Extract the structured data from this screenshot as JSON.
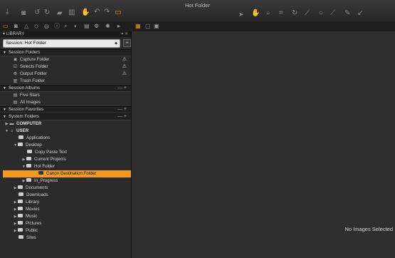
{
  "window": {
    "title": "Hot Folder"
  },
  "toolbar": {
    "left_icons": [
      "import-icon",
      "camera-icon",
      "rotate-left-icon",
      "rotate-right-icon",
      "folder-icon",
      "trash-icon",
      "hand-icon",
      "undo-icon",
      "redo-icon",
      "stack-icon"
    ],
    "right_icons": [
      "select-arrow-icon",
      "pan-icon",
      "zoom-icon",
      "crop-icon",
      "rotate-icon",
      "straighten-icon",
      "circle-icon",
      "picker-icon",
      "brush-icon"
    ],
    "accent": "#f29a1a"
  },
  "tool_tabs": [
    "folder-tab",
    "camera-tab",
    "shape-tab",
    "color-tab",
    "lens-tab",
    "info-tab",
    "search-tab",
    "meta-tab",
    "list-tab",
    "settings-tab",
    "more-tab"
  ],
  "library": {
    "header": "LIBRARY",
    "session_label": "Session: Hot Folder",
    "session_add": "+",
    "sections": {
      "session_folders": "Session Folders",
      "session_albums": "Session Albums",
      "session_favorites": "Session Favorites",
      "system_folders": "System Folders"
    },
    "session_folders": [
      {
        "label": "Capture Folder",
        "icon": "camera-icon",
        "warn": "⚠"
      },
      {
        "label": "Selects Folder",
        "icon": "check-icon",
        "warn": "⚠"
      },
      {
        "label": "Output Folder",
        "icon": "gear-icon",
        "warn": "⚠"
      },
      {
        "label": "Trash Folder",
        "icon": "trash-icon",
        "warn": ""
      }
    ],
    "albums": [
      {
        "label": "Five Stars",
        "icon": "album-icon"
      },
      {
        "label": "All Images",
        "icon": "album-icon"
      }
    ],
    "computer": "COMPUTER",
    "user": "USER",
    "tree": {
      "applications": "Applications",
      "desktop": "Desktop",
      "copy_paste_text": "Copy Paste Text",
      "current_projects": "Current Projects",
      "hot_folder": "Hot Folder",
      "canon_destination": "Canon Destination Folder",
      "in_progress": "In_Progress",
      "documents": "Documents",
      "downloads": "Downloads",
      "library": "Library",
      "movies": "Movies",
      "music": "Music",
      "pictures": "Pictures",
      "public": "Public",
      "sites": "Sites"
    }
  },
  "viewer": {
    "empty_text": "No Images Selected"
  }
}
